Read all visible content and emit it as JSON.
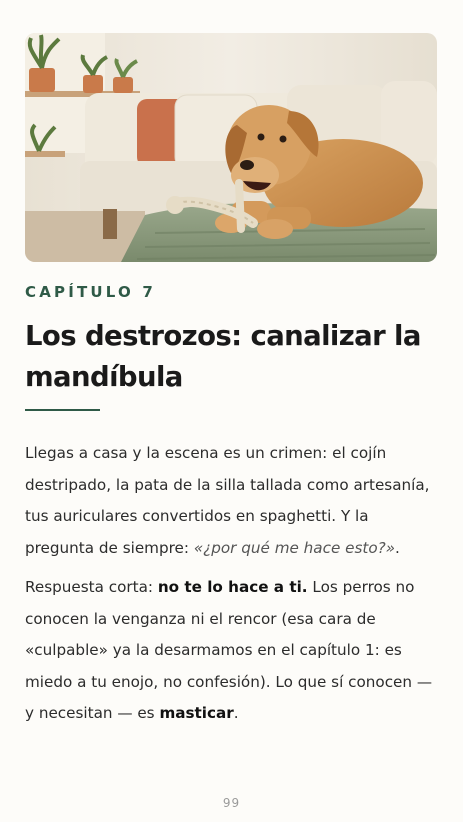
{
  "photo": {
    "subject": "dog-chewing-rope-toy-on-sofa-icon"
  },
  "chapter": {
    "label": "CAPÍTULO 7",
    "title": "Los destrozos: canalizar la mandíbula"
  },
  "paragraphs": [
    {
      "text_1": "Llegas a casa y la escena es un crimen: el cojín destripado, la pata de la silla tallada como artesanía, tus auriculares convertidos en spaghetti. Y la pregunta de siempre: ",
      "quote": "«¿por qué me hace esto?»",
      "text_2": "."
    },
    {
      "text_1": "Respuesta corta: ",
      "strong_1": "no te lo hace a ti.",
      "text_2": " Los perros no conocen la venganza ni el rencor (esa cara de «culpable» ya la desarmamos en el capítulo 1: es miedo a tu enojo, no confesión). Lo que sí conocen — y necesitan — es ",
      "strong_2": "masticar",
      "text_3": "."
    }
  ],
  "footer": {
    "page_number": "99"
  },
  "colors": {
    "accent": "#2f5a47",
    "text": "#2c2c2c",
    "background": "#fdfcf9"
  }
}
